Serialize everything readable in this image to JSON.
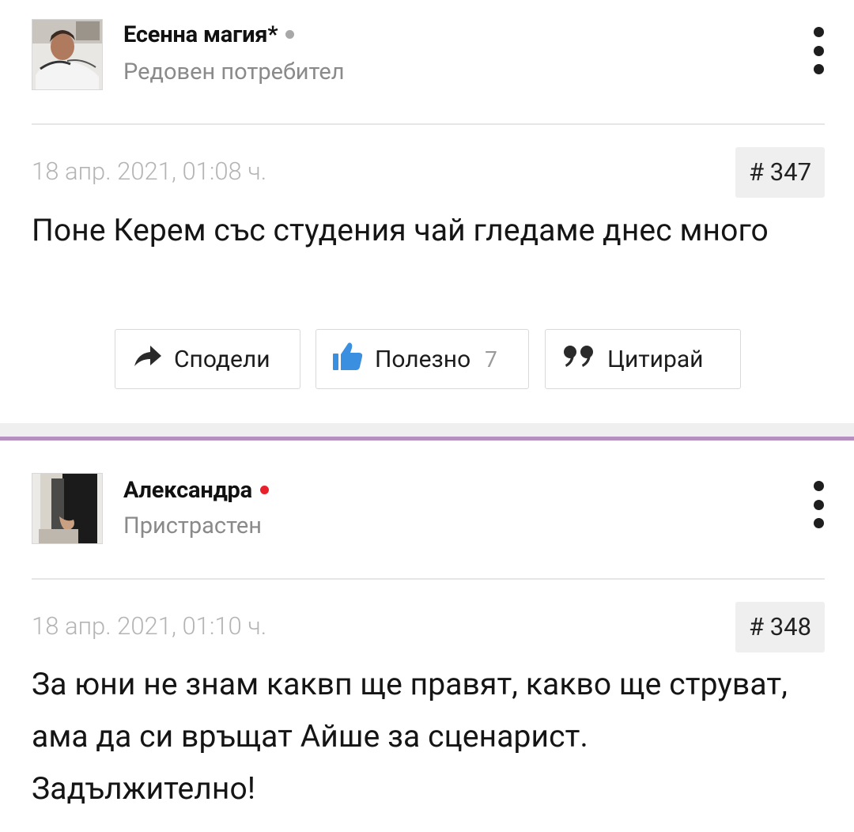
{
  "posts": [
    {
      "author": "Есенна магия*",
      "rank": "Редовен потребител",
      "online_color": "#a8a8a8",
      "date": "18 апр. 2021, 01:08 ч.",
      "number": "# 347",
      "text": "Поне Керем със студения чай гледаме днес много",
      "actions": {
        "share": "Сподели",
        "like": "Полезно",
        "like_count": "7",
        "quote": "Цитирай"
      }
    },
    {
      "author": "Александра",
      "rank": "Пристрастен",
      "online_color": "#e8202a",
      "date": "18 апр. 2021, 01:10 ч.",
      "number": "# 348",
      "text": "За юни не знам каквп ще правят, какво ще струват, ама да си връщат Айше за сценарист. Задължително!"
    }
  ],
  "colors": {
    "accent_separator": "#b48fc0",
    "like_icon": "#3b8fe0"
  },
  "icons": {
    "share": "share-arrow-icon",
    "like": "thumbs-up-icon",
    "quote": "quote-icon",
    "more": "vertical-dots-icon"
  }
}
